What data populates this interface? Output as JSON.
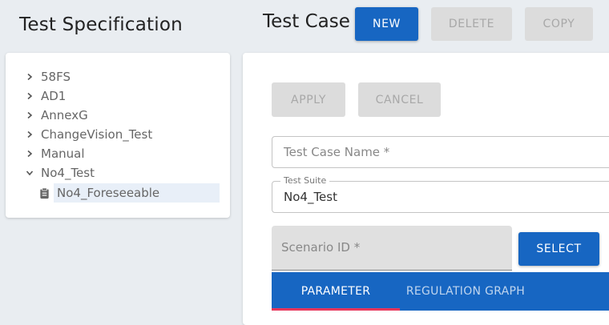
{
  "left_panel": {
    "title": "Test Specification",
    "tree": [
      {
        "label": "58FS",
        "expanded": false
      },
      {
        "label": "AD1",
        "expanded": false
      },
      {
        "label": "AnnexG",
        "expanded": false
      },
      {
        "label": "ChangeVision_Test",
        "expanded": false
      },
      {
        "label": "Manual",
        "expanded": false
      },
      {
        "label": "No4_Test",
        "expanded": true
      }
    ],
    "selected_child": {
      "label": "No4_Foreseeable",
      "icon": "clipboard-icon"
    }
  },
  "header": {
    "title": "Test Case",
    "new_label": "NEW",
    "delete_label": "DELETE",
    "copy_label": "COPY"
  },
  "form": {
    "apply_label": "APPLY",
    "cancel_label": "CANCEL",
    "test_case_name_placeholder": "Test Case Name *",
    "test_suite_legend": "Test Suite",
    "test_suite_value": "No4_Test",
    "scenario_id_placeholder": "Scenario ID *",
    "select_label": "SELECT"
  },
  "tabs": [
    {
      "label": "PARAMETER",
      "active": true
    },
    {
      "label": "REGULATION GRAPH",
      "active": false
    }
  ],
  "colors": {
    "primary": "#1766c2",
    "tab_indicator": "#e8355a",
    "background": "#e9edf1"
  }
}
